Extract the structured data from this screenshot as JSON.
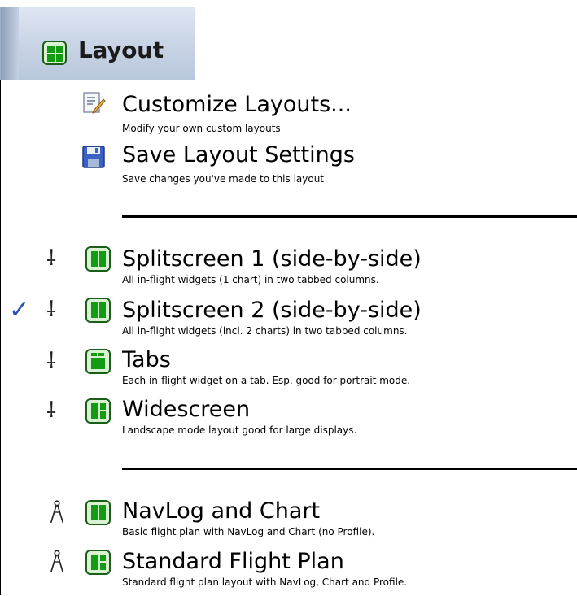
{
  "tab": {
    "label": "Layout",
    "icon": "layout-grid-icon"
  },
  "menu": {
    "customize": {
      "title": "Customize Layouts...",
      "desc": "Modify your own custom layouts",
      "icon": "edit-document-icon"
    },
    "save": {
      "title": "Save Layout Settings",
      "desc": "Save changes you've made to this layout",
      "icon": "floppy-disk-icon"
    },
    "inflight": [
      {
        "title": "Splitscreen 1 (side-by-side)",
        "desc": "All in-flight widgets (1 chart) in two tabbed columns.",
        "checked": false,
        "icon": "two-column-layout-icon"
      },
      {
        "title": "Splitscreen 2 (side-by-side)",
        "desc": "All in-flight widgets (incl. 2 charts) in two tabbed columns.",
        "checked": true,
        "icon": "two-column-layout-icon"
      },
      {
        "title": "Tabs",
        "desc": "Each in-flight widget on a tab.  Esp. good for portrait mode.",
        "checked": false,
        "icon": "tabbed-layout-icon"
      },
      {
        "title": "Widescreen",
        "desc": "Landscape mode layout good for large displays.",
        "checked": false,
        "icon": "wide-layout-icon"
      }
    ],
    "planning": [
      {
        "title": "NavLog and Chart",
        "desc": "Basic flight plan with NavLog and Chart (no Profile).",
        "icon": "two-column-layout-icon"
      },
      {
        "title": "Standard Flight Plan",
        "desc": "Standard flight plan layout with NavLog, Chart and Profile.",
        "icon": "wide-layout-icon"
      }
    ]
  },
  "colors": {
    "accent_green": "#139c13",
    "check_blue": "#2a4fb8",
    "tab_blue": "#cbd6e7"
  }
}
